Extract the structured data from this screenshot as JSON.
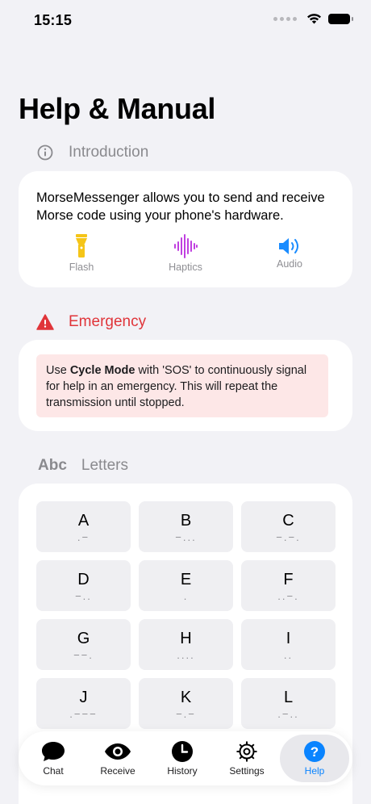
{
  "status": {
    "time": "15:15"
  },
  "page": {
    "title": "Help & Manual"
  },
  "introduction": {
    "header": "Introduction",
    "text": "MorseMessenger allows you to send and receive Morse code using your phone's hardware.",
    "features": [
      {
        "label": "Flash",
        "icon": "flashlight-icon",
        "color": "#f5c518"
      },
      {
        "label": "Haptics",
        "icon": "waveform-icon",
        "color": "#c040e0"
      },
      {
        "label": "Audio",
        "icon": "speaker-icon",
        "color": "#1a8cff"
      }
    ]
  },
  "emergency": {
    "header": "Emergency",
    "text_prefix": "Use ",
    "text_bold": "Cycle Mode",
    "text_suffix": " with 'SOS' to continuously signal for help in an emergency. This will repeat the transmission until stopped.",
    "color": "#e0353a"
  },
  "letters": {
    "header_icon_text": "Abc",
    "header": "Letters",
    "items": [
      {
        "letter": "A",
        "code": ".−"
      },
      {
        "letter": "B",
        "code": "−..."
      },
      {
        "letter": "C",
        "code": "−.−."
      },
      {
        "letter": "D",
        "code": "−.."
      },
      {
        "letter": "E",
        "code": "."
      },
      {
        "letter": "F",
        "code": "..−."
      },
      {
        "letter": "G",
        "code": "−−."
      },
      {
        "letter": "H",
        "code": "...."
      },
      {
        "letter": "I",
        "code": ".."
      },
      {
        "letter": "J",
        "code": ".−−−"
      },
      {
        "letter": "K",
        "code": "−.−"
      },
      {
        "letter": "L",
        "code": ".−.."
      }
    ]
  },
  "tabs": [
    {
      "label": "Chat",
      "icon": "chat-bubble-icon"
    },
    {
      "label": "Receive",
      "icon": "eye-icon"
    },
    {
      "label": "History",
      "icon": "clock-icon"
    },
    {
      "label": "Settings",
      "icon": "gear-icon"
    },
    {
      "label": "Help",
      "icon": "question-icon",
      "active": true
    }
  ],
  "accent_color": "#0a84ff"
}
